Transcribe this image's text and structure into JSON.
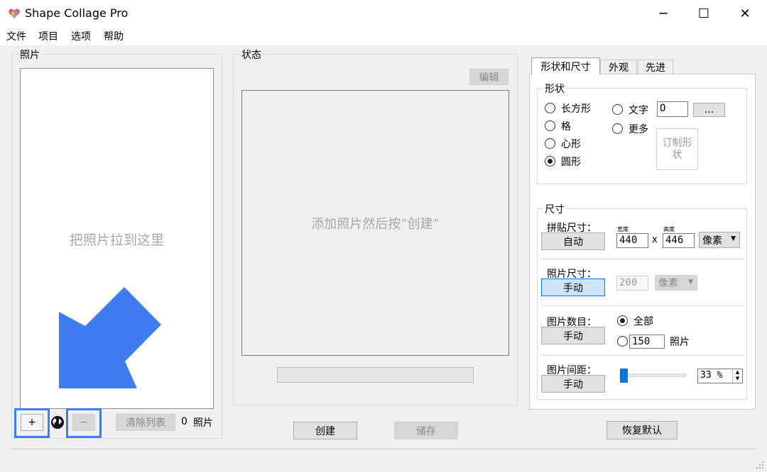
{
  "window": {
    "title": "Shape Collage Pro"
  },
  "window_controls": {
    "minimize": "─",
    "maximize": "☐",
    "close": "✕"
  },
  "menu": {
    "file": "文件",
    "project": "项目",
    "options": "选项",
    "help": "帮助"
  },
  "photos": {
    "group_label": "照片",
    "drop_hint": "把照片拉到这里",
    "add_label": "+",
    "remove_label": "−",
    "clear_label": "清除列表",
    "count": "0",
    "count_unit": "照片"
  },
  "status": {
    "group_label": "状态",
    "edit_label": "编辑",
    "preview_hint": "添加照片然后按“创建”"
  },
  "actions": {
    "create": "创建",
    "save": "储存",
    "restore_defaults": "恢复默认"
  },
  "tabs": {
    "shape_size": "形状和尺寸",
    "appearance": "外观",
    "advanced": "先进"
  },
  "shape": {
    "group_label": "形状",
    "rectangle": "长方形",
    "grid": "格",
    "heart": "心形",
    "circle": "圆形",
    "text": "文字",
    "more": "更多",
    "text_value": "O",
    "ellipsis_label": "...",
    "custom_label": "订制形状",
    "selected": "circle"
  },
  "size": {
    "group_label": "尺寸",
    "collage_size_label": "拼贴尺寸：",
    "collage_mode": "自动",
    "width_caption": "宽度",
    "height_caption": "高度",
    "width": "440",
    "times": "x",
    "height": "446",
    "unit": "像素",
    "photo_size_label": "照片尺寸：",
    "photo_mode": "手动",
    "photo_size": "200",
    "photo_unit": "像素",
    "count_label": "图片数目：",
    "count_mode": "手动",
    "count_all": "全部",
    "count_value": "150",
    "count_unit": "照片",
    "spacing_label": "图片间距：",
    "spacing_mode": "手动",
    "spacing_percent": 33,
    "spacing_text": "33 %"
  },
  "colors": {
    "highlight": "#3d7cf2",
    "arrow": "#3d7cf2",
    "slider_thumb": "#0078d7"
  }
}
